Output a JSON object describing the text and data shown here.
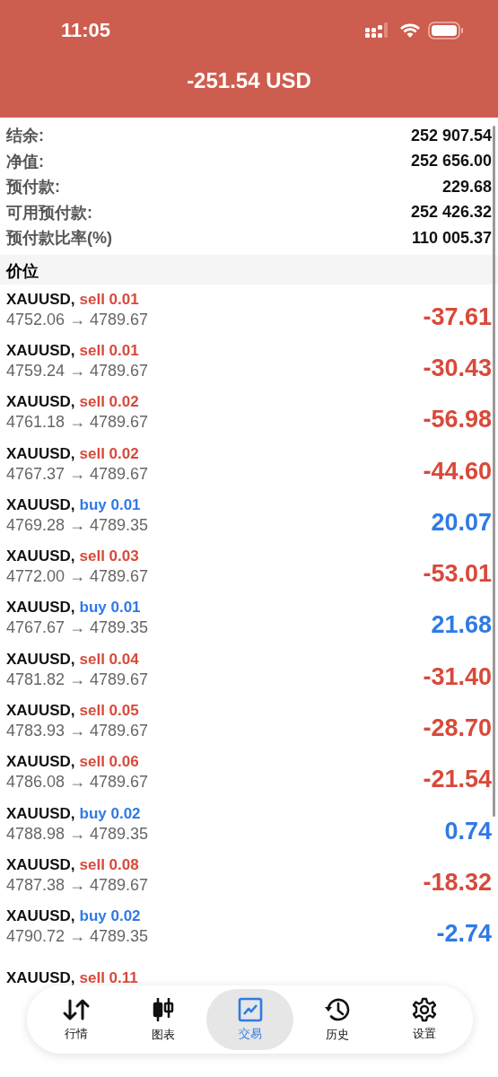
{
  "status_bar": {
    "time": "11:05"
  },
  "header": {
    "title": "-251.54 USD"
  },
  "summary": [
    {
      "label": "结余:",
      "value": "252 907.54"
    },
    {
      "label": "净值:",
      "value": "252 656.00"
    },
    {
      "label": "预付款:",
      "value": "229.68"
    },
    {
      "label": "可用预付款:",
      "value": "252 426.32"
    },
    {
      "label": "预付款比率(%)",
      "value": "110 005.37"
    }
  ],
  "section_title": "价位",
  "positions": [
    {
      "symbol": "XAUUSD,",
      "kind": "sell",
      "order": "sell 0.01",
      "prices": "4752.06 → 4789.67",
      "profit": "-37.61"
    },
    {
      "symbol": "XAUUSD,",
      "kind": "sell",
      "order": "sell 0.01",
      "prices": "4759.24 → 4789.67",
      "profit": "-30.43"
    },
    {
      "symbol": "XAUUSD,",
      "kind": "sell",
      "order": "sell 0.02",
      "prices": "4761.18 → 4789.67",
      "profit": "-56.98"
    },
    {
      "symbol": "XAUUSD,",
      "kind": "sell",
      "order": "sell 0.02",
      "prices": "4767.37 → 4789.67",
      "profit": "-44.60"
    },
    {
      "symbol": "XAUUSD,",
      "kind": "buy",
      "order": "buy 0.01",
      "prices": "4769.28 → 4789.35",
      "profit": "20.07"
    },
    {
      "symbol": "XAUUSD,",
      "kind": "sell",
      "order": "sell 0.03",
      "prices": "4772.00 → 4789.67",
      "profit": "-53.01"
    },
    {
      "symbol": "XAUUSD,",
      "kind": "buy",
      "order": "buy 0.01",
      "prices": "4767.67 → 4789.35",
      "profit": "21.68"
    },
    {
      "symbol": "XAUUSD,",
      "kind": "sell",
      "order": "sell 0.04",
      "prices": "4781.82 → 4789.67",
      "profit": "-31.40"
    },
    {
      "symbol": "XAUUSD,",
      "kind": "sell",
      "order": "sell 0.05",
      "prices": "4783.93 → 4789.67",
      "profit": "-28.70"
    },
    {
      "symbol": "XAUUSD,",
      "kind": "sell",
      "order": "sell 0.06",
      "prices": "4786.08 → 4789.67",
      "profit": "-21.54"
    },
    {
      "symbol": "XAUUSD,",
      "kind": "buy",
      "order": "buy 0.02",
      "prices": "4788.98 → 4789.35",
      "profit": "0.74"
    },
    {
      "symbol": "XAUUSD,",
      "kind": "sell",
      "order": "sell 0.08",
      "prices": "4787.38 → 4789.67",
      "profit": "-18.32"
    },
    {
      "symbol": "XAUUSD,",
      "kind": "buy",
      "order": "buy 0.02",
      "prices": "4790.72 → 4789.35",
      "profit": "-2.74"
    },
    {
      "symbol": "XAUUSD,",
      "kind": "sell",
      "order": "sell 0.11"
    }
  ],
  "tab_bar": [
    {
      "kind": "quotes",
      "label": "行情",
      "selected": false
    },
    {
      "kind": "chart",
      "label": "图表",
      "selected": false
    },
    {
      "kind": "trade",
      "label": "交易",
      "selected": true
    },
    {
      "kind": "history",
      "label": "历史",
      "selected": false
    },
    {
      "kind": "settings",
      "label": "设置",
      "selected": false
    }
  ]
}
